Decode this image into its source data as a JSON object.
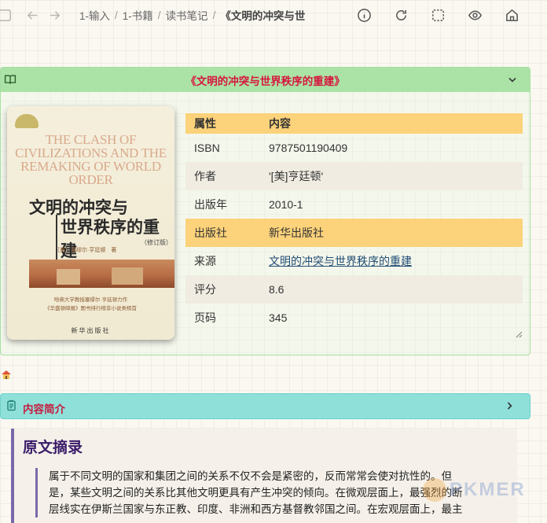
{
  "breadcrumb": {
    "items": [
      "1-输入",
      "1-书籍",
      "读书笔记"
    ],
    "current": "《文明的冲突与世"
  },
  "book_callout": {
    "title": "《文明的冲突与世界秩序的重建》",
    "cover": {
      "en_title": "THE CLASH OF CIVILIZATIONS AND THE REMAKING OF WORLD ORDER",
      "zh_title_line1": "文明的冲突与",
      "zh_title_line2": "世界秩序的重建",
      "edition": "（修订版）",
      "author_line": "［美］塞缪尔·亨廷顿　著",
      "blurb_line1": "哈佛大学教授塞缪尔·亨廷顿力作",
      "blurb_line2": "《华盛顿邮报》图书排行榜非小说类榜首",
      "publisher": "新华出版社"
    },
    "table": {
      "headers": [
        "属性",
        "内容"
      ],
      "rows": [
        {
          "key": "ISBN",
          "value": "9787501190409"
        },
        {
          "key": "作者",
          "value": "'[美]亨廷顿'"
        },
        {
          "key": "出版年",
          "value": "2010-1"
        },
        {
          "key": "出版社",
          "value": "新华出版社"
        },
        {
          "key": "来源",
          "value": "文明的冲突与世界秩序的重建"
        },
        {
          "key": "评分",
          "value": "8.6"
        },
        {
          "key": "页码",
          "value": "345"
        }
      ]
    }
  },
  "intro_callout": {
    "title": "内容简介"
  },
  "excerpt": {
    "heading": "原文摘录",
    "lines": [
      "属于不同文明的国家和集团之间的关系不仅不会是紧密的，反而常常会使对抗性的。但",
      "是，某些文明之间的关系比其他文明更具有产生冲突的倾向。在微观层面上，最强烈的断",
      "层线实在伊斯兰国家与东正教、印度、非洲和西方基督教邻国之间。在宏观层面上，最主"
    ]
  },
  "watermark": "PKMER",
  "colors": {
    "book_header": "#abe2a6",
    "intro_header": "#8ee0d9",
    "table_highlight": "#fcd27a",
    "title_red": "#d6163d"
  }
}
